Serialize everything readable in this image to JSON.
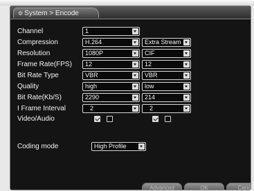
{
  "window": {
    "title": "System > Encode"
  },
  "form": {
    "channel": {
      "label": "Channel",
      "value": "1"
    },
    "compression": {
      "label": "Compression",
      "main": "H.264",
      "extra": "Extra Stream"
    },
    "resolution": {
      "label": "Resolution",
      "main": "1080P",
      "extra": "CIF"
    },
    "frame_rate": {
      "label": "Frame Rate(FPS)",
      "main": "12",
      "extra": "12"
    },
    "bit_rate_type": {
      "label": "Bit Rate Type",
      "main": "VBR",
      "extra": "VBR"
    },
    "quality": {
      "label": "Quality",
      "main": "high",
      "extra": "low"
    },
    "bit_rate": {
      "label": "Bit Rate(Kb/S)",
      "main": "2290",
      "extra": "214"
    },
    "i_frame_interval": {
      "label": "I Frame Interval",
      "main": "2",
      "extra": "2"
    },
    "video_audio": {
      "label": "Video/Audio",
      "main_video": true,
      "main_audio": false,
      "extra_video": true,
      "extra_audio": false
    },
    "coding_mode": {
      "label": "Coding mode",
      "value": "High Profile"
    }
  },
  "buttons": {
    "advanced": "Advanced",
    "ok": "OK",
    "cancel": "Cancel"
  },
  "icons": {
    "title": "settings-icon",
    "dropdown": "chevron-down-icon"
  }
}
